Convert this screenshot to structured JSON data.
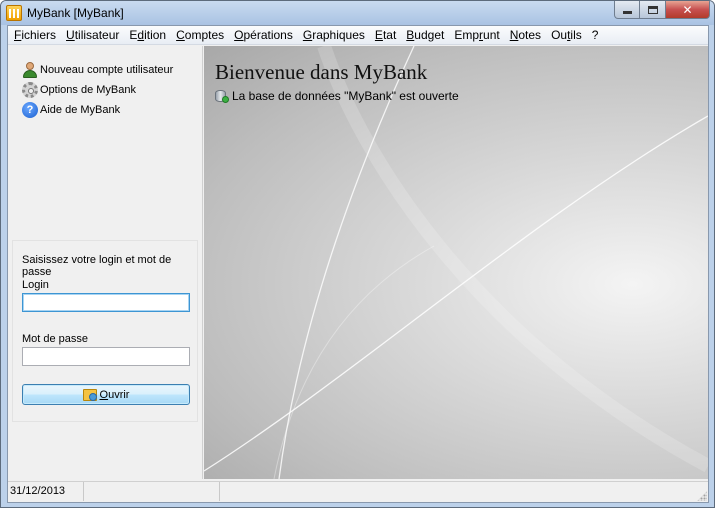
{
  "window": {
    "title": "MyBank [MyBank]",
    "close_glyph": "✕"
  },
  "menu": [
    {
      "pre": "",
      "u": "F",
      "post": "ichiers"
    },
    {
      "pre": "",
      "u": "U",
      "post": "tilisateur"
    },
    {
      "pre": "E",
      "u": "d",
      "post": "ition"
    },
    {
      "pre": "",
      "u": "C",
      "post": "omptes"
    },
    {
      "pre": "",
      "u": "O",
      "post": "pérations"
    },
    {
      "pre": "",
      "u": "G",
      "post": "raphiques"
    },
    {
      "pre": "",
      "u": "E",
      "post": "tat"
    },
    {
      "pre": "",
      "u": "B",
      "post": "udget"
    },
    {
      "pre": "Emp",
      "u": "r",
      "post": "unt"
    },
    {
      "pre": "",
      "u": "N",
      "post": "otes"
    },
    {
      "pre": "Ou",
      "u": "t",
      "post": "ils"
    },
    {
      "pre": "?",
      "u": "",
      "post": ""
    }
  ],
  "sidebar": {
    "links": [
      {
        "label": "Nouveau compte utilisateur",
        "icon": "user-icon"
      },
      {
        "label": "Options de MyBank",
        "icon": "gear-icon"
      },
      {
        "label": "Aide de MyBank",
        "icon": "help-icon"
      }
    ],
    "help_glyph": "?"
  },
  "login": {
    "title": "Saisissez votre login et mot de passe",
    "login_label": "Login",
    "login_value": "",
    "password_label": "Mot de passe",
    "password_value": "",
    "open_button": "Ouvrir"
  },
  "main": {
    "welcome_title": "Bienvenue dans MyBank",
    "db_status": "La base de données \"MyBank\" est ouverte"
  },
  "statusbar": {
    "date": "31/12/2013",
    "cell2": "",
    "cell3": ""
  }
}
